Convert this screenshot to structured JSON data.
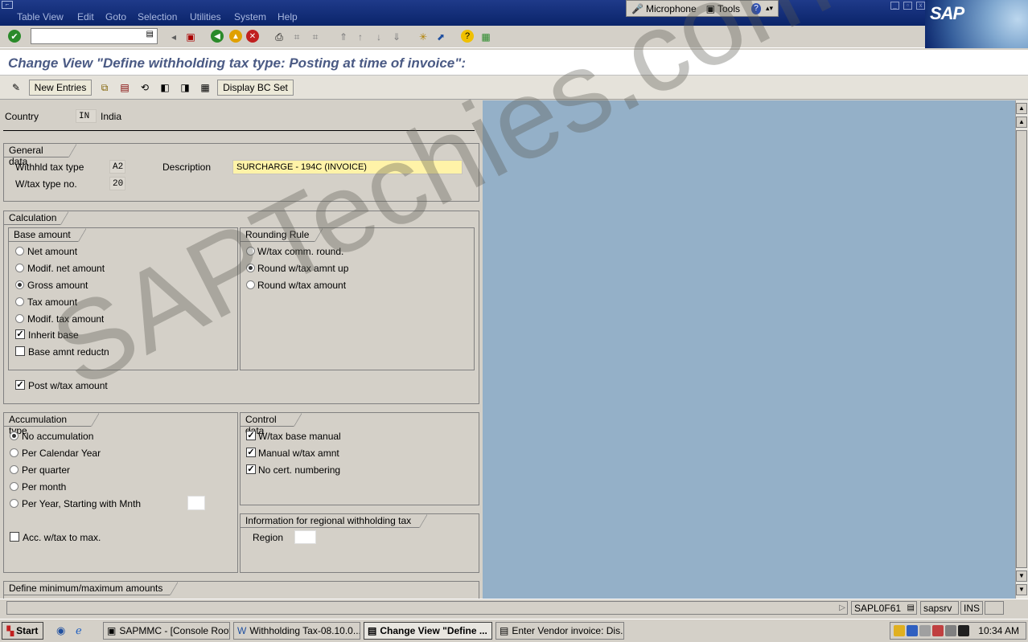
{
  "menu": [
    "Table View",
    "Edit",
    "Goto",
    "Selection",
    "Utilities",
    "System",
    "Help"
  ],
  "mictools": {
    "microphone": "Microphone",
    "tools": "Tools"
  },
  "sap_logo": "SAP",
  "title": "Change View \"Define withholding tax type: Posting at time of invoice\":",
  "app_toolbar": {
    "new_entries": "New Entries",
    "display_bc_set": "Display BC Set"
  },
  "country": {
    "label": "Country",
    "code": "IN",
    "name": "India"
  },
  "general": {
    "title": "General data",
    "whld_label": "Withhld tax type",
    "whld_value": "A2",
    "typeno_label": "W/tax type no.",
    "typeno_value": "20",
    "desc_label": "Description",
    "desc_value": "SURCHARGE - 194C (INVOICE)"
  },
  "calculation": {
    "title": "Calculation",
    "base_amount": {
      "title": "Base amount",
      "options": [
        "Net amount",
        "Modif. net amount",
        "Gross amount",
        "Tax amount",
        "Modif. tax amount"
      ],
      "selected": 2,
      "inherit_base": "Inherit base",
      "inherit_base_checked": true,
      "base_reduct": "Base amnt reductn",
      "base_reduct_checked": false
    },
    "rounding": {
      "title": "Rounding Rule",
      "options": [
        "W/tax comm. round.",
        "Round w/tax amnt up",
        "Round w/tax amount"
      ],
      "selected": 1
    },
    "post_wtax": "Post w/tax amount",
    "post_wtax_checked": true
  },
  "accumulation": {
    "title": "Accumulation type",
    "options": [
      "No accumulation",
      "Per Calendar Year",
      "Per quarter",
      "Per month",
      "Per Year, Starting with Mnth"
    ],
    "selected": 0,
    "acc_max": "Acc. w/tax to max.",
    "acc_max_checked": false
  },
  "control": {
    "title": "Control data",
    "items": [
      {
        "label": "W/tax base manual",
        "checked": true
      },
      {
        "label": "Manual w/tax amnt",
        "checked": true
      },
      {
        "label": "No cert. numbering",
        "checked": true
      }
    ]
  },
  "regional": {
    "title": "Information for regional withholding tax",
    "region_label": "Region",
    "region_value": ""
  },
  "minmax": {
    "title": "Define minimum/maximum amounts"
  },
  "status": {
    "program": "SAPL0F61",
    "server": "sapsrv",
    "mode": "INS"
  },
  "taskbar": {
    "start": "Start",
    "tasks": [
      "SAPMMC - [Console Root...",
      "Withholding Tax-08.10.0...",
      "Change View \"Define ...",
      "Enter Vendor invoice: Dis..."
    ],
    "clock": "10:34 AM"
  },
  "watermark": "SAPTechies.com"
}
